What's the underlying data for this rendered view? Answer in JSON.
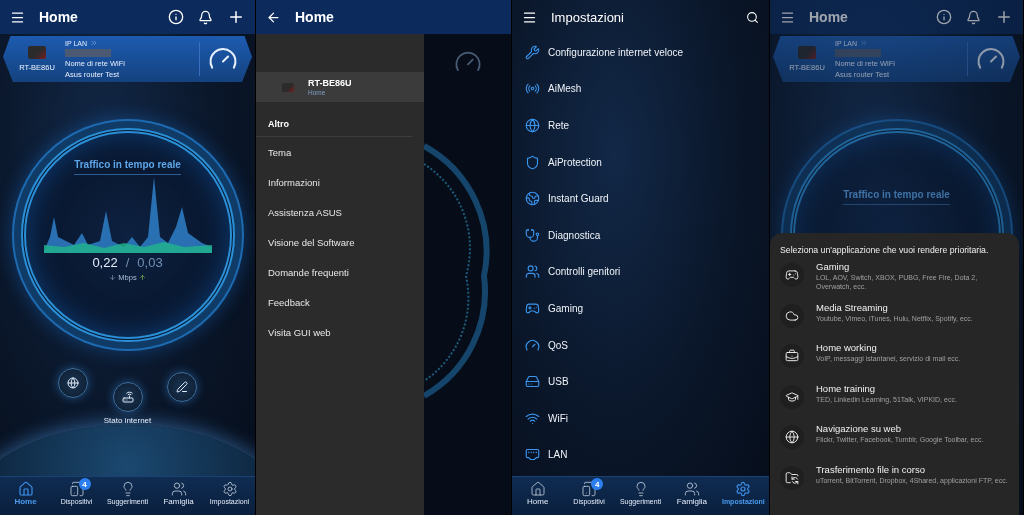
{
  "screens": [
    {
      "kind": "home",
      "header": {
        "title": "Home"
      },
      "router_card": {
        "model": "RT-BE86U",
        "ip_label": "IP LAN",
        "network_name": "Nome di rete WiFi",
        "router_name": "Asus router Test"
      },
      "traffic": {
        "title": "Traffico in tempo reale",
        "download": "0,22",
        "separator": "/",
        "upload": "0,03",
        "unit": "Mbps"
      },
      "status_label": "Stato internet",
      "nav": [
        {
          "label": "Home",
          "selected": true
        },
        {
          "label": "Dispositivi",
          "selected": false,
          "badge": "4"
        },
        {
          "label": "Suggerimenti",
          "selected": false
        },
        {
          "label": "Famiglia",
          "selected": false
        },
        {
          "label": "Impostazioni",
          "selected": false
        }
      ]
    },
    {
      "kind": "drawer",
      "header": {
        "title": "Home"
      },
      "router": {
        "model": "RT-BE86U",
        "location": "Home"
      },
      "section": "Altro",
      "items": [
        "Tema",
        "Informazioni",
        "Assistenza ASUS",
        "Visione del Software",
        "Domande frequenti",
        "Feedback",
        "Visita GUI web"
      ]
    },
    {
      "kind": "settings",
      "header": {
        "title": "Impostazioni"
      },
      "items": [
        "Configurazione internet veloce",
        "AiMesh",
        "Rete",
        "AiProtection",
        "Instant Guard",
        "Diagnostica",
        "Controlli genitori",
        "Gaming",
        "QoS",
        "USB",
        "WiFi",
        "LAN"
      ],
      "nav": [
        {
          "label": "Home",
          "selected": false
        },
        {
          "label": "Dispositivi",
          "selected": false,
          "badge": "4"
        },
        {
          "label": "Suggerimenti",
          "selected": false
        },
        {
          "label": "Famiglia",
          "selected": false
        },
        {
          "label": "Impostazioni",
          "selected": true
        }
      ]
    },
    {
      "kind": "priority",
      "header": {
        "title": "Home"
      },
      "router_card": {
        "model": "RT-BE86U",
        "ip_label": "IP LAN",
        "network_name": "Nome di rete WiFi",
        "router_name": "Asus router Test"
      },
      "traffic_title": "Traffico in tempo reale",
      "sheet": {
        "prompt": "Seleziona un'applicazione che vuoi rendere prioritaria.",
        "options": [
          {
            "title": "Gaming",
            "detail": "LOL, AOV, Switch, XBOX, PUBG, Free Fire, Dota 2, Overwatch, ecc."
          },
          {
            "title": "Media Streaming",
            "detail": "Youtube, Vimeo, iTunes, Hulu, Netflix, Spotify, ecc."
          },
          {
            "title": "Home working",
            "detail": "VoIP, messaggi istantanei, servizio di mail ecc."
          },
          {
            "title": "Home training",
            "detail": "TED, Linkedin Learning, 51Talk, VIPKID, ecc."
          },
          {
            "title": "Navigazione su web",
            "detail": "Flickr, Twitter, Facebook, Tumblr, Google Toolbar, ecc."
          },
          {
            "title": "Trasferimento file in corso",
            "detail": "uTorrent, BitTorrent, Dropbox, 4Shared, applicazioni FTP, ecc."
          }
        ]
      }
    }
  ]
}
